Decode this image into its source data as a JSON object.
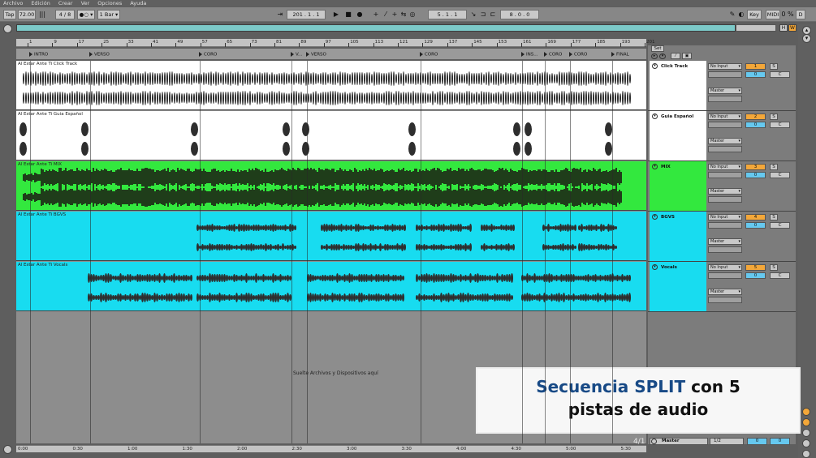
{
  "menu": [
    "Archivo",
    "Edición",
    "Crear",
    "Ver",
    "Opciones",
    "Ayuda"
  ],
  "transport": {
    "tap": "Tap",
    "tempo": "72.00",
    "signature": "4 / 8",
    "metronome": "●○ ▾",
    "quantize": "1 Bar ▾",
    "position": "201 .  1 .  1",
    "loop_start": "5 .  1 .  1",
    "loop_length": "8 .  0 .  0",
    "key": "Key",
    "midi": "MIDI",
    "cpu": "0 %",
    "record_mode": "D"
  },
  "overview_buttons": {
    "h": "H",
    "w": "W"
  },
  "ruler_bars": [
    "1",
    "9",
    "17",
    "25",
    "33",
    "41",
    "49",
    "57",
    "65",
    "73",
    "81",
    "89",
    "97",
    "105",
    "113",
    "121",
    "129",
    "137",
    "145",
    "153",
    "161",
    "169",
    "177",
    "185",
    "193",
    "201"
  ],
  "locators": [
    "INTRO",
    "VERSO",
    "CORO",
    "V...",
    "VERSO",
    "CORO",
    "INS...",
    "CORO",
    "CORO",
    "FINAL"
  ],
  "tracks": [
    {
      "clip": "Al Estar Ante Ti Click Track",
      "name": "Click Track",
      "number": "1",
      "color": "#ffffff",
      "input": "No Input",
      "output": "Master",
      "send": "0",
      "pan": "C",
      "solo": "S"
    },
    {
      "clip": "Al Estar Ante Ti Guia Español",
      "name": "Guia Español",
      "number": "2",
      "color": "#ffffff",
      "input": "No Input",
      "output": "Master",
      "send": "0",
      "pan": "C",
      "solo": "S"
    },
    {
      "clip": "Al Estar Ante Ti MIX",
      "name": "MIX",
      "number": "3",
      "color": "#33e83e",
      "input": "No Input",
      "output": "Master",
      "send": "0",
      "pan": "C",
      "solo": "S"
    },
    {
      "clip": "Al Estar Ante Ti BGVS",
      "name": "BGVS",
      "number": "4",
      "color": "#18dcf0",
      "input": "No Input",
      "output": "Master",
      "send": "0",
      "pan": "C",
      "solo": "S"
    },
    {
      "clip": "Al Estar Ante Ti Vocals",
      "name": "Vocals",
      "number": "5",
      "color": "#18dcf0",
      "input": "No Input",
      "output": "Master",
      "send": "0",
      "pan": "C",
      "solo": "S"
    }
  ],
  "mixer_header": {
    "set": "Set"
  },
  "drop_text": "Suelte Archivos y Dispositivos aquí",
  "time_ruler": [
    "0:00",
    "0:30",
    "1:00",
    "1:30",
    "2:00",
    "2:30",
    "3:00",
    "3:30",
    "4:00",
    "4:30",
    "5:00",
    "5:30"
  ],
  "bar_display": "4/1",
  "master": {
    "name": "Master",
    "fraction": "1/2",
    "send": "0",
    "vol": "0"
  },
  "overlay": {
    "line1_highlight": "Secuencia SPLIT",
    "line1_rest": "con 5",
    "line2": "pistas de audio"
  },
  "colors": {
    "accent_orange": "#f3a739",
    "accent_blue": "#66c8ef",
    "overview": "#7cc9c8",
    "mix_track": "#33e83e",
    "vocal_tracks": "#18dcf0",
    "overlay_highlight": "#184a86"
  }
}
